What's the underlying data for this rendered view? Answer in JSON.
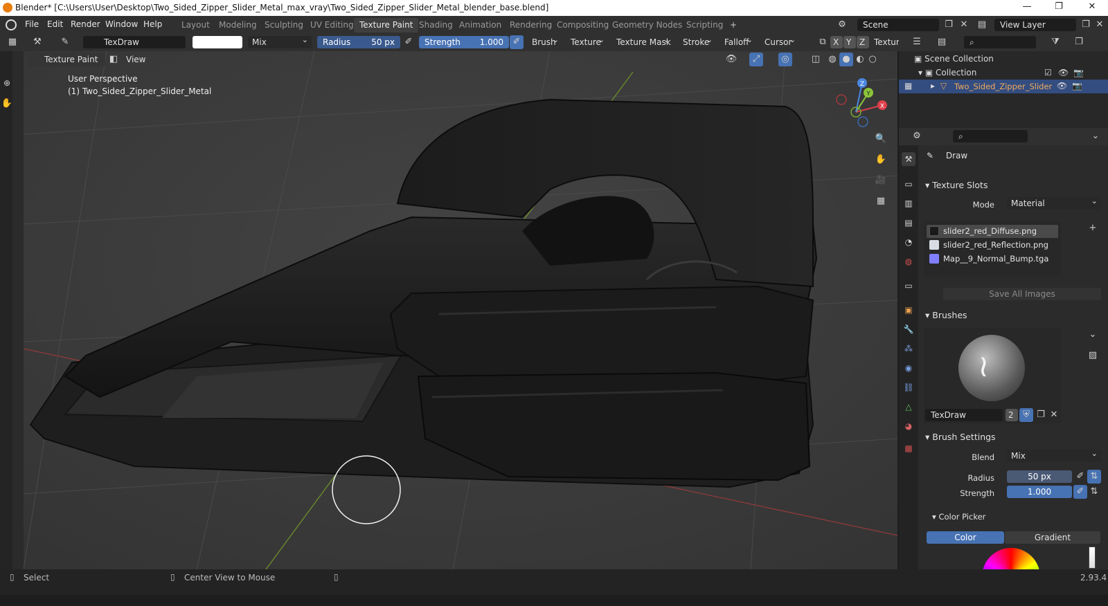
{
  "titlebar": {
    "title": "Blender* [C:\\Users\\User\\Desktop\\Two_Sided_Zipper_Slider_Metal_max_vray\\Two_Sided_Zipper_Slider_Metal_blender_base.blend]",
    "minimize": "—",
    "maximize": "❐",
    "close": "✕"
  },
  "menu": [
    "File",
    "Edit",
    "Render",
    "Window",
    "Help"
  ],
  "workspaces": [
    "Layout",
    "Modeling",
    "Sculpting",
    "UV Editing",
    "Texture Paint",
    "Shading",
    "Animation",
    "Rendering",
    "Compositing",
    "Geometry Nodes",
    "Scripting",
    "+"
  ],
  "active_workspace": "Texture Paint",
  "scene": {
    "label": "Scene",
    "view_layer": "View Layer"
  },
  "tool_header": {
    "brush_name": "TexDraw",
    "blend": "Mix",
    "radius_label": "Radius",
    "radius_value": "50 px",
    "strength_label": "Strength",
    "strength_value": "1.000",
    "menus": [
      "Brush",
      "Texture",
      "Texture Mask",
      "Stroke",
      "Falloff",
      "Cursor"
    ],
    "axes": [
      "X",
      "Y",
      "Z"
    ],
    "texture_label": "Texture"
  },
  "viewport_header": {
    "mode": "Texture Paint",
    "view": "View"
  },
  "viewport": {
    "perspective": "User Perspective",
    "object": "(1) Two_Sided_Zipper_Slider_Metal",
    "gizmo": {
      "x": "X",
      "y": "Y",
      "z": "Z"
    }
  },
  "outliner": {
    "scene_collection": "Scene Collection",
    "collection": "Collection",
    "object": "Two_Sided_Zipper_Slider"
  },
  "properties": {
    "tool_name": "Draw",
    "texture_slots_title": "Texture Slots",
    "mode_label": "Mode",
    "mode_value": "Material",
    "slots": [
      {
        "name": "slider2_red_Diffuse.png",
        "color": "#1a1a1a"
      },
      {
        "name": "slider2_red_Reflection.png",
        "color": "#d9dde3"
      },
      {
        "name": "Map__9_Normal_Bump.tga",
        "color": "#7f7fff"
      }
    ],
    "save_all": "Save All Images",
    "brushes_title": "Brushes",
    "brush_name": "TexDraw",
    "brush_users": "2",
    "brush_settings_title": "Brush Settings",
    "blend_label": "Blend",
    "blend_value": "Mix",
    "radius_label": "Radius",
    "radius_value": "50 px",
    "strength_label": "Strength",
    "strength_value": "1.000",
    "color_picker_title": "Color Picker",
    "color_tab": "Color",
    "gradient_tab": "Gradient"
  },
  "statusbar": {
    "select": "Select",
    "center": "Center View to Mouse",
    "version": "2.93.4"
  },
  "colors": {
    "accent": "#4772b3",
    "header": "#303030",
    "object": "#1c1c1c"
  }
}
